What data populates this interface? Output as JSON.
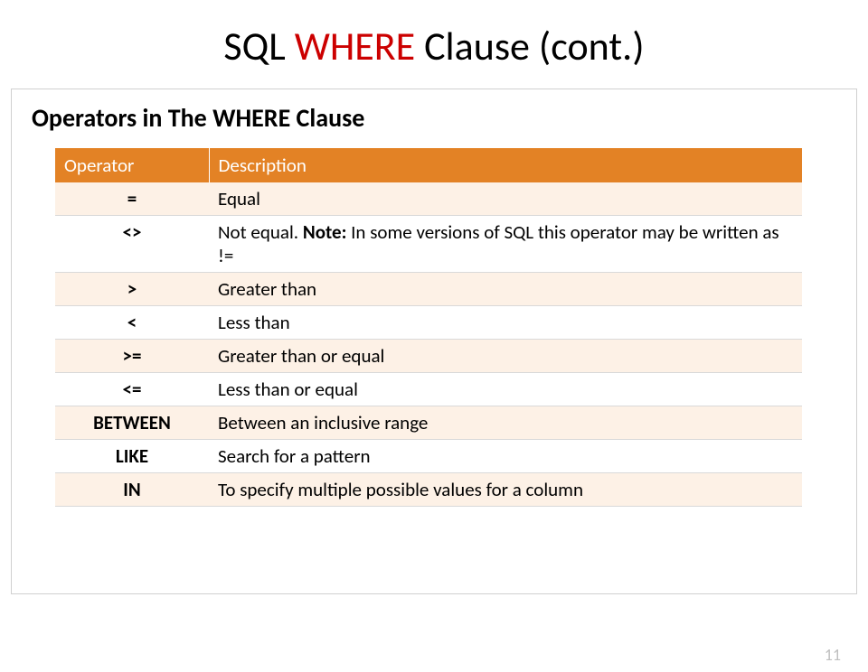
{
  "title": {
    "pre": "SQL ",
    "highlight": "WHERE",
    "post": " Clause (cont.)"
  },
  "subtitle": "Operators in The WHERE Clause",
  "columns": {
    "c1": "Operator",
    "c2": "Description"
  },
  "rows": [
    {
      "op": "=",
      "desc_pre": "Equal",
      "note": "",
      "desc_post": ""
    },
    {
      "op": "<>",
      "desc_pre": "Not equal. ",
      "note": "Note:",
      "desc_post": " In some versions of SQL this operator may be written as !="
    },
    {
      "op": ">",
      "desc_pre": "Greater than",
      "note": "",
      "desc_post": ""
    },
    {
      "op": "<",
      "desc_pre": "Less than",
      "note": "",
      "desc_post": ""
    },
    {
      "op": ">=",
      "desc_pre": "Greater than or equal",
      "note": "",
      "desc_post": ""
    },
    {
      "op": "<=",
      "desc_pre": "Less than or equal",
      "note": "",
      "desc_post": ""
    },
    {
      "op": "BETWEEN",
      "desc_pre": "Between an inclusive range",
      "note": "",
      "desc_post": ""
    },
    {
      "op": "LIKE",
      "desc_pre": "Search for a pattern",
      "note": "",
      "desc_post": ""
    },
    {
      "op": "IN",
      "desc_pre": "To specify multiple possible values for a column",
      "note": "",
      "desc_post": ""
    }
  ],
  "page_number": "11"
}
